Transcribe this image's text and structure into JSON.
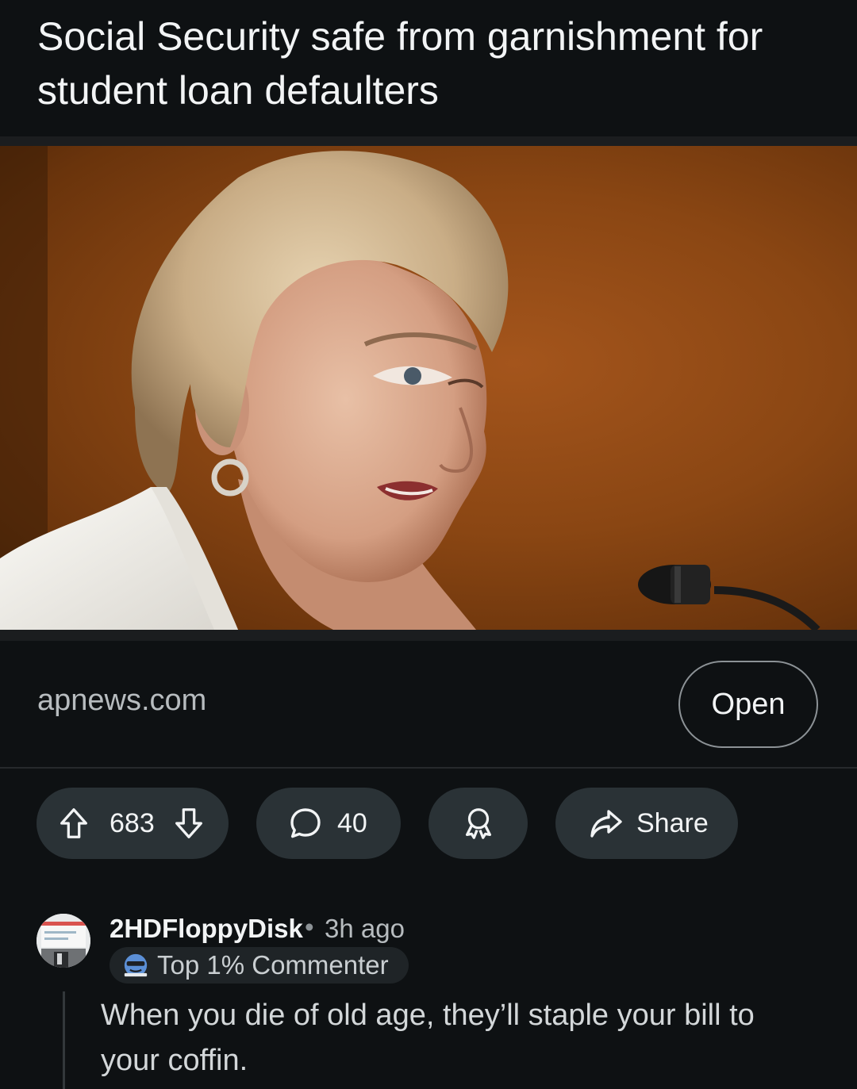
{
  "post": {
    "title": "Social Security safe from garnishment for student loan defaulters",
    "domain": "apnews.com",
    "open_label": "Open"
  },
  "actions": {
    "score": "683",
    "comment_count": "40",
    "share_label": "Share"
  },
  "comment": {
    "username": "2HDFloppyDisk",
    "separator": "•",
    "time": "3h ago",
    "badge": "Top 1% Commenter",
    "body": "When you die of old age, they’ll staple your bill to your coffin."
  },
  "icons": {
    "upvote": "arrow-up-outline-icon",
    "downvote": "arrow-down-outline-icon",
    "comments": "speech-bubble-icon",
    "award": "award-ribbon-icon",
    "share": "share-arrow-icon"
  },
  "colors": {
    "background": "#0e1113",
    "pill": "#2a3236",
    "text": "#f2f4f5",
    "muted": "#b7bcbf",
    "photo_backdrop": "#8a4613"
  }
}
